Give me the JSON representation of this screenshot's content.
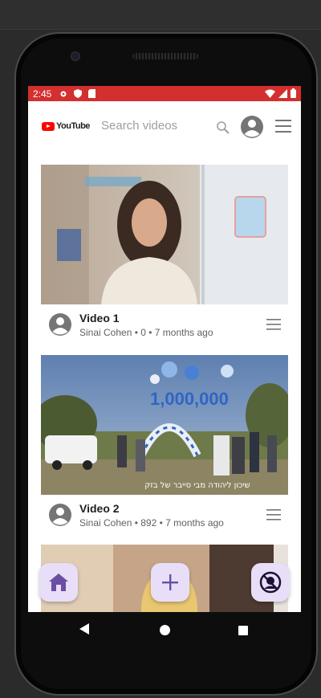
{
  "status_bar": {
    "time": "2:45"
  },
  "app_bar": {
    "logo_text": "YouTube",
    "search_placeholder": "Search videos"
  },
  "videos": [
    {
      "title": "Video 1",
      "subtitle": "Sinai Cohen • 0 • 7 months ago"
    },
    {
      "title": "Video 2",
      "subtitle": "Sinai Cohen • 892 • 7 months ago",
      "thumbnail_caption": "שיכון ליהודה מבי סייבר של בזק",
      "thumbnail_balloon_text": "1,000,000"
    }
  ],
  "fabs": [
    {
      "name": "home",
      "icon": "home-icon"
    },
    {
      "name": "add",
      "icon": "plus-icon"
    },
    {
      "name": "incognito",
      "icon": "no-entry-icon"
    }
  ],
  "colors": {
    "status_bar": "#d32f2f",
    "fab_bg": "#e8def8",
    "fab_icon": "#6a4fa3"
  }
}
